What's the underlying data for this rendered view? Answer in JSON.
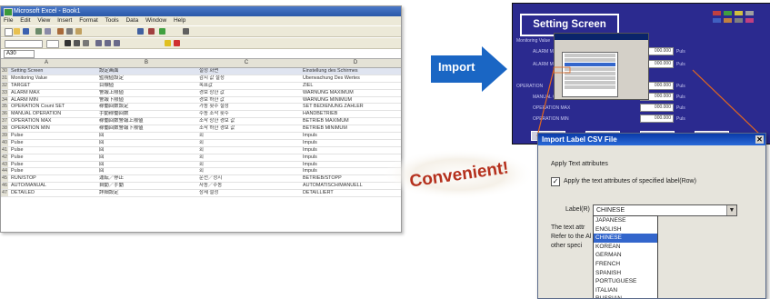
{
  "spreadsheet": {
    "title": "Microsoft Excel - Book1",
    "menu": [
      "File",
      "Edit",
      "View",
      "Insert",
      "Format",
      "Tools",
      "Data",
      "Window",
      "Help"
    ],
    "namebox": "A30",
    "col_headers": [
      "A",
      "B",
      "C",
      "D"
    ],
    "rows": [
      {
        "n": "30",
        "c1": "Setting Screen",
        "c2": "設定画面",
        "c3": "설정 화면",
        "c4": "Einstellung des Schirmes"
      },
      {
        "n": "31",
        "c1": "Monitoring Value",
        "c2": "監視値設定",
        "c3": "감시 값 설정",
        "c4": "Überwachung Des Wertes"
      },
      {
        "n": "32",
        "c1": "TARGET",
        "c2": "目標値",
        "c3": "목표값",
        "c4": "ZIEL"
      },
      {
        "n": "33",
        "c1": "ALARM MAX",
        "c2": "警報上限値",
        "c3": "경보 상한 값",
        "c4": "WARNUNG MAXIMUM"
      },
      {
        "n": "34",
        "c1": "ALARM MIN",
        "c2": "警報下限値",
        "c3": "경보 하한 값",
        "c4": "WARNUNG MINIMUM"
      },
      {
        "n": "35",
        "c1": "OPERATION Count SET",
        "c2": "稼働回数設定",
        "c3": "가동 횟수 설정",
        "c4": "SET BEDIENUNG ZÄHLER"
      },
      {
        "n": "36",
        "c1": "MANUAL OPERATION",
        "c2": "手動稼働回数",
        "c3": "수동 조작 횟수",
        "c4": "HANDBETRIEB"
      },
      {
        "n": "37",
        "c1": "OPERATION MAX",
        "c2": "稼働回数警報上限値",
        "c3": "조작 상한 경보 값",
        "c4": "BETRIEB MAXIMUM"
      },
      {
        "n": "38",
        "c1": "OPERATION MIN",
        "c2": "稼働回数警報下限値",
        "c3": "조작 하한 경보 값",
        "c4": "BETRIEB MINIMUM"
      },
      {
        "n": "39",
        "c1": "Pulse",
        "c2": "回",
        "c3": "회",
        "c4": "Impuls"
      },
      {
        "n": "40",
        "c1": "Pulse",
        "c2": "回",
        "c3": "회",
        "c4": "Impuls"
      },
      {
        "n": "41",
        "c1": "Pulse",
        "c2": "回",
        "c3": "회",
        "c4": "Impuls"
      },
      {
        "n": "42",
        "c1": "Pulse",
        "c2": "回",
        "c3": "회",
        "c4": "Impuls"
      },
      {
        "n": "43",
        "c1": "Pulse",
        "c2": "回",
        "c3": "회",
        "c4": "Impuls"
      },
      {
        "n": "44",
        "c1": "Pulse",
        "c2": "回",
        "c3": "회",
        "c4": "Impuls"
      },
      {
        "n": "45",
        "c1": "RUN/STOP",
        "c2": "運転／停止",
        "c3": "운전／정지",
        "c4": "BETRIEB/STOPP"
      },
      {
        "n": "46",
        "c1": "AUTO/MANUAL",
        "c2": "自動／手動",
        "c3": "자동／수동",
        "c4": "AUTOMATISCH/MANUELL"
      },
      {
        "n": "47",
        "c1": "DETAILED",
        "c2": "詳細設定",
        "c3": "상세 설정",
        "c4": "DETAILLIERT"
      }
    ]
  },
  "import_label": "Import",
  "setting_screen": {
    "title": "Setting Screen",
    "monitor_label": "Monitoring Value",
    "rows": [
      {
        "label": "ALARM MAX",
        "value": "000.000",
        "unit": "Puls"
      },
      {
        "label": "ALARM MIN",
        "value": "000.000",
        "unit": "Puls"
      },
      {
        "label": "OPERATION",
        "value": "000.000",
        "unit": "Puls"
      },
      {
        "label": "MANUAL OPERATION",
        "value": "000.000",
        "unit": "Puls"
      },
      {
        "label": "OPERATION MAX",
        "value": "000.000",
        "unit": "Puls"
      },
      {
        "label": "OPERATION MIN",
        "value": "000.000",
        "unit": "Puls"
      }
    ]
  },
  "dialog": {
    "title": "Import Label CSV File",
    "group_label": "Apply Text attributes",
    "checkbox_label": "Apply the text attributes of specified label(Row)",
    "label_row_caption": "Label(R)",
    "selected_language": "CHINESE",
    "note_lines": [
      "The text attr",
      "Refer to the Al",
      "other speci"
    ],
    "languages": [
      "JAPANESE",
      "ENGLISH",
      "CHINESE",
      "KOREAN",
      "GERMAN",
      "FRENCH",
      "SPANISH",
      "PORTUGUESE",
      "ITALIAN",
      "RUSSIAN"
    ],
    "highlighted_index": 2
  },
  "convenient_label": "Convenient!",
  "colors": {
    "arrow": "#1a66c4",
    "convenient_text": "#b5311e",
    "setting_bg": "#2b2a8f",
    "callout_line": "#e2671e"
  }
}
